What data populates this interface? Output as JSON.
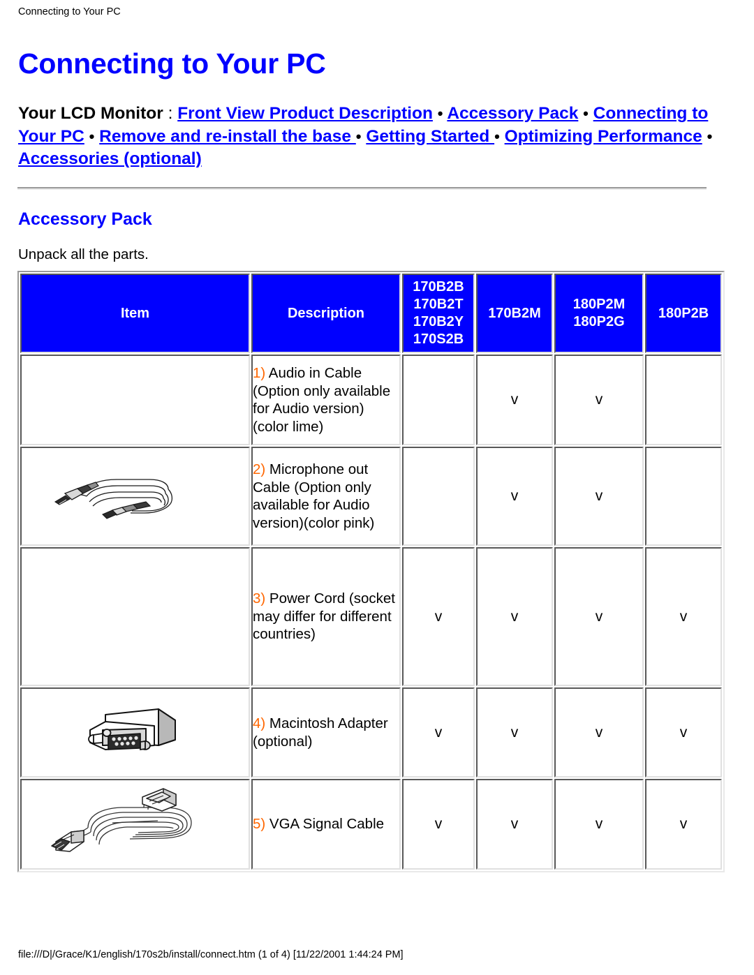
{
  "print_header": "Connecting to Your PC",
  "print_footer": "file:///D|/Grace/K1/english/170s2b/install/connect.htm (1 of 4) [11/22/2001 1:44:24 PM]",
  "page_title": "Connecting to Your PC",
  "colors": {
    "link": "#0000ff",
    "heading": "#0000ff",
    "header_cell_bg": "#0000ff",
    "header_cell_text": "#ffffff",
    "number_accent": "#ff6600",
    "body_text": "#000000"
  },
  "nav": {
    "lead": "Your LCD Monitor",
    "colon": " : ",
    "separator": "•",
    "links": [
      "Front View Product Description",
      "Accessory Pack",
      "Connecting to Your PC",
      "Remove and re-install the base ",
      "Getting Started ",
      "Optimizing Performance",
      "Accessories (optional)"
    ]
  },
  "section": {
    "title": "Accessory Pack",
    "intro": "Unpack all the parts."
  },
  "table": {
    "headers": {
      "item": "Item",
      "description": "Description",
      "group1": "170B2B\n170B2T\n170B2Y\n170S2B",
      "group1_lines": [
        "170B2B",
        "170B2T",
        "170B2Y",
        "170S2B"
      ],
      "group2": "170B2M",
      "group3_lines": [
        "180P2M",
        "180P2G"
      ],
      "group4": "180P2B"
    },
    "rows": [
      {
        "num": "1)",
        "desc": " Audio in Cable (Option only available for Audio version)(color lime)",
        "image": "none",
        "image_alt": "",
        "g1": "",
        "g2": "v",
        "g3": "v",
        "g4": ""
      },
      {
        "num": "2)",
        "desc": " Microphone out Cable (Option only available for Audio version)(color pink)",
        "image": "audio-cable",
        "image_alt": "coiled audio cable with two 3.5mm jack plugs",
        "g1": "",
        "g2": "v",
        "g3": "v",
        "g4": ""
      },
      {
        "num": "3)",
        "desc": " Power Cord (socket may differ for different countries)",
        "image": "none",
        "image_alt": "",
        "g1": "v",
        "g2": "v",
        "g3": "v",
        "g4": "v"
      },
      {
        "num": "4)",
        "desc": " Macintosh Adapter (optional)",
        "image": "mac-adapter",
        "image_alt": "Macintosh VGA adapter connector",
        "g1": "v",
        "g2": "v",
        "g3": "v",
        "g4": "v"
      },
      {
        "num": "5)",
        "desc": " VGA Signal Cable",
        "image": "vga-cable",
        "image_alt": "coiled VGA signal cable with D-sub connectors",
        "g1": "v",
        "g2": "v",
        "g3": "v",
        "g4": "v"
      }
    ]
  }
}
